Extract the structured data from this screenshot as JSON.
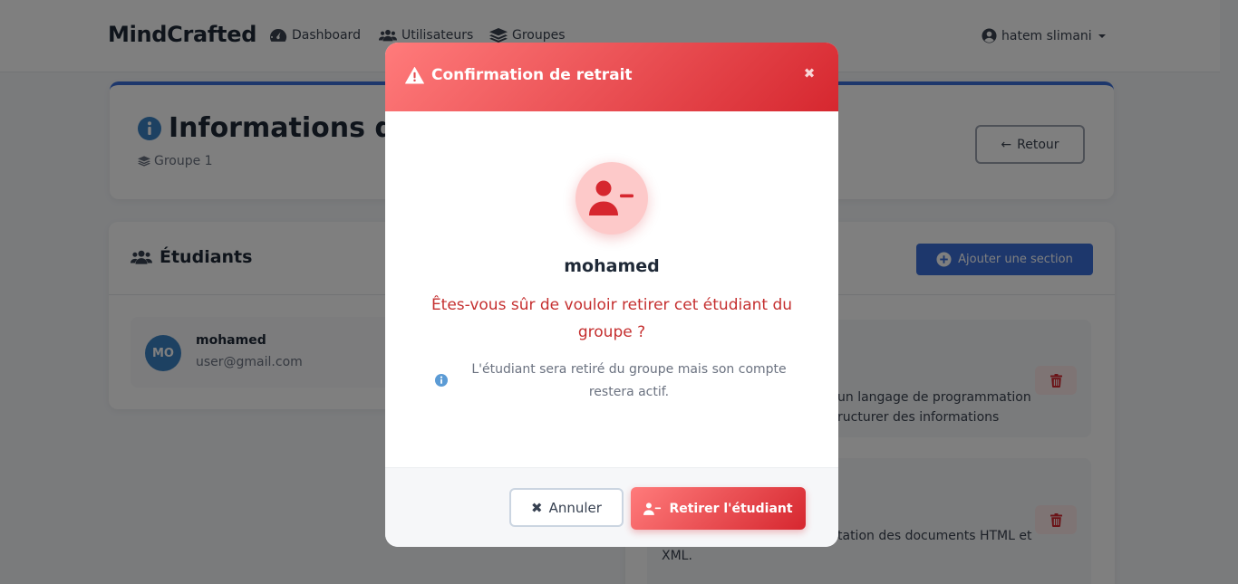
{
  "navbar": {
    "brand": "MindCrafted",
    "links": [
      {
        "label": "Dashboard",
        "icon": "tachometer-icon"
      },
      {
        "label": "Utilisateurs",
        "icon": "users-icon"
      },
      {
        "label": "Groupes",
        "icon": "layers-icon"
      }
    ],
    "user": {
      "name": "hatem slimani",
      "icon": "user-circle-icon"
    }
  },
  "header": {
    "title": "Informations du",
    "subtitle": "Groupe 1",
    "back_label": "Retour"
  },
  "students": {
    "title": "Étudiants",
    "items": [
      {
        "initials": "MO",
        "name": "mohamed",
        "email": "user@gmail.com"
      }
    ]
  },
  "sections": {
    "add_label": "Ajouter une section",
    "items": [
      {
        "desc_line1": "un langage de programmation",
        "desc_line2": "ructurer des informations"
      },
      {
        "desc_line1": "tation des documents HTML et",
        "desc_line2": "XML."
      }
    ]
  },
  "modal": {
    "title": "Confirmation de retrait",
    "close": "✖",
    "student_name": "mohamed",
    "question": "Êtes-vous sûr de vouloir retirer cet étudiant du groupe ?",
    "info": "L'étudiant sera retiré du groupe mais son compte restera actif.",
    "cancel_label": "Annuler",
    "cancel_glyph": "✖",
    "confirm_label": "Retirer l'étudiant"
  },
  "colors": {
    "accent": "#3b6fd8",
    "danger_start": "#ff7b7b",
    "danger_end": "#d6272f",
    "danger_text": "#c53030",
    "avatar": "#3b82c4"
  }
}
